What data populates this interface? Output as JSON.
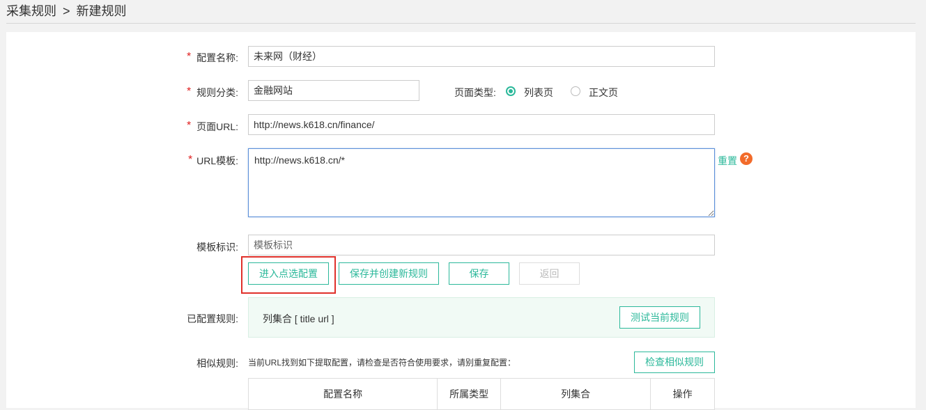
{
  "breadcrumb": {
    "parent": "采集规则",
    "sep": ">",
    "current": "新建规则"
  },
  "form": {
    "req_mark": "*",
    "config_name": {
      "label": "配置名称:",
      "value": "未来网（财经）"
    },
    "rule_category": {
      "label": "规则分类:",
      "value": "金融网站"
    },
    "page_type": {
      "label": "页面类型:",
      "options": [
        "列表页",
        "正文页"
      ],
      "selected": "列表页"
    },
    "page_url": {
      "label": "页面URL:",
      "value": "http://news.k618.cn/finance/"
    },
    "url_template": {
      "label": "URL模板:",
      "value": "http://news.k618.cn/*",
      "reset_label": "重置",
      "help": "?"
    },
    "template_tag": {
      "label": "模板标识:",
      "placeholder": "模板标识"
    }
  },
  "buttons": {
    "enter_select": "进入点选配置",
    "save_and_new": "保存并创建新规则",
    "save": "保存",
    "back": "返回"
  },
  "configured": {
    "label": "已配置规则:",
    "summary": "列集合 [ title   url ]",
    "test_button": "测试当前规则"
  },
  "similar": {
    "label": "相似规则:",
    "notice": "当前URL找到如下提取配置，请检查是否符合使用要求，请别重复配置：",
    "check_button": "检查相似规则",
    "columns": [
      "配置名称",
      "所属类型",
      "列集合",
      "操作"
    ]
  },
  "colors": {
    "accent": "#2bb89a",
    "required": "#e02020",
    "highlight": "#e0302a",
    "help": "#f26b2a"
  }
}
